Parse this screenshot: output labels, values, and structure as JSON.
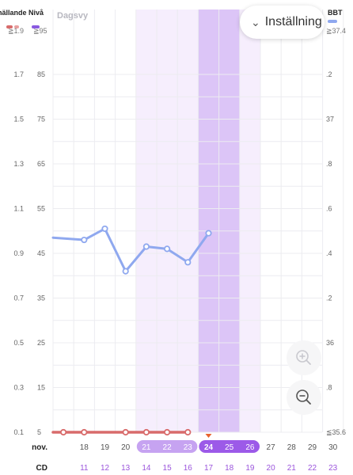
{
  "header": {
    "left_title": "nällande Nivå",
    "left_sub_a": "≧1.9",
    "left_sub_b": "≧95",
    "day_mode": "Dagsvy",
    "right_title": "BBT",
    "right_sub": "≧37.4",
    "settings_label": "Inställning"
  },
  "axes": {
    "left_a": [
      "1.7",
      "1.5",
      "1.3",
      "1.1",
      "0.9",
      "0.7",
      "0.5",
      "0.3",
      "0.1"
    ],
    "left_b": [
      "85",
      "75",
      "65",
      "55",
      "45",
      "35",
      "25",
      "15",
      "5"
    ],
    "right": [
      ".2",
      "37",
      ".8",
      ".6",
      ".4",
      ".2",
      "36",
      ".8",
      "≦35.6"
    ]
  },
  "row_labels": {
    "month": "nov.",
    "cycle": "CD"
  },
  "dates": [
    "18",
    "19",
    "20",
    "21",
    "22",
    "23",
    "24",
    "25",
    "26",
    "27",
    "28",
    "29",
    "30"
  ],
  "cycle_days": [
    "11",
    "12",
    "13",
    "14",
    "15",
    "16",
    "17",
    "18",
    "19",
    "20",
    "21",
    "22",
    "23"
  ],
  "colors": {
    "line_blue": "#8fa8ef",
    "line_red": "#d86b6b",
    "band_light": "#f6eefd",
    "band_strong": "#dcc5f7",
    "pill_light": "#c6a3f1",
    "pill_strong": "#9c5ae8",
    "cd_text": "#9b55dc",
    "marker": "#e8632f"
  },
  "chart_data": {
    "type": "line",
    "x": [
      "17",
      "18",
      "19",
      "20",
      "21",
      "22",
      "23",
      "24"
    ],
    "series": [
      {
        "values": [
          0.97,
          0.96,
          1.01,
          0.82,
          0.93,
          0.92,
          0.86,
          0.99
        ]
      },
      {
        "values": [
          5,
          5,
          null,
          5,
          5,
          5,
          5,
          null
        ]
      }
    ],
    "ylim_left_a": [
      0.1,
      1.9
    ],
    "ylim_left_b": [
      5,
      95
    ],
    "right_axis": "BBT",
    "today": "24",
    "highlight_light": [
      "21",
      "22",
      "23",
      "26"
    ],
    "highlight_strong": [
      "24",
      "25"
    ]
  },
  "controls": {
    "zoom_in": "zoom-in",
    "zoom_out": "zoom-out"
  }
}
